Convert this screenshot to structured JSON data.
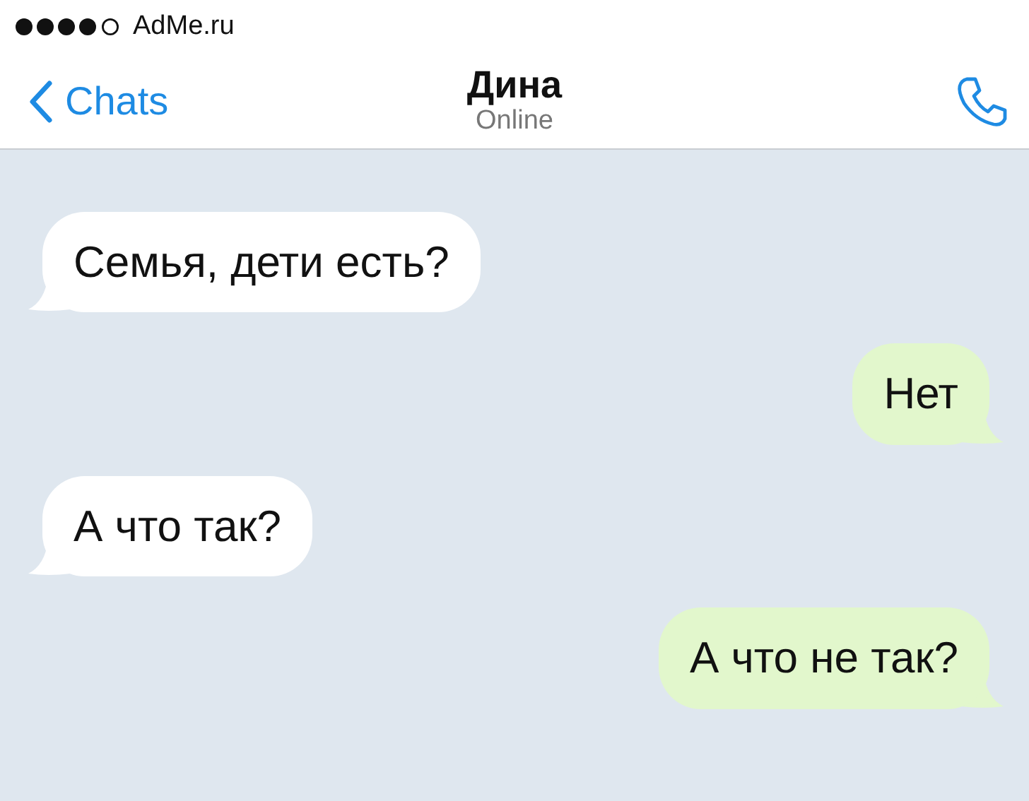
{
  "status_bar": {
    "carrier": "AdMe.ru"
  },
  "header": {
    "back": "Chats",
    "title": "Дина",
    "subtitle": "Online"
  },
  "messages": [
    {
      "text": "Семья, дети есть?",
      "kind": "incoming"
    },
    {
      "text": "Нет",
      "kind": "outgoing"
    },
    {
      "text": "А что так?",
      "kind": "incoming"
    },
    {
      "text": "А что не так?",
      "kind": "outgoing"
    }
  ]
}
